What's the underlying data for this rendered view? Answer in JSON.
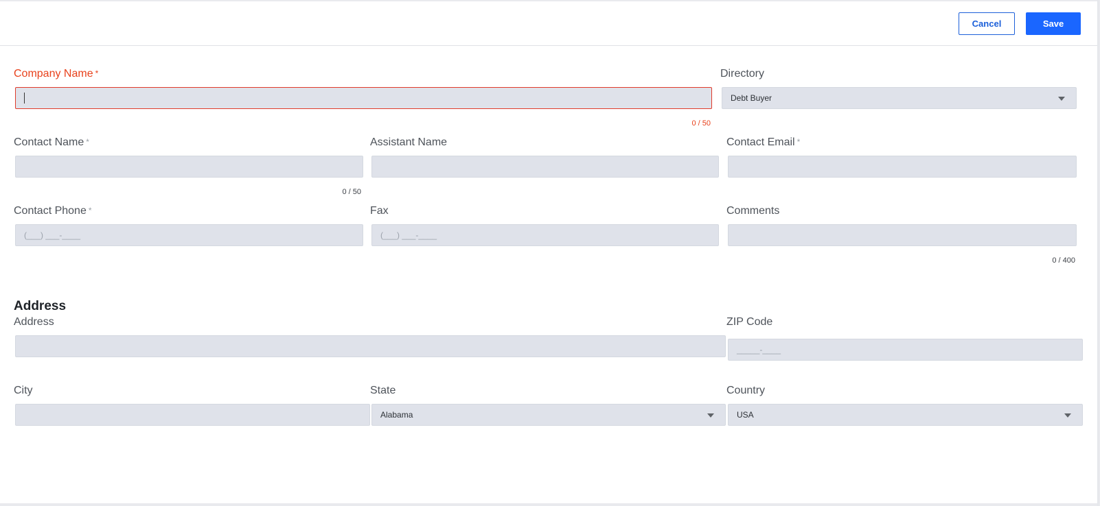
{
  "toolbar": {
    "cancel_label": "Cancel",
    "save_label": "Save"
  },
  "fields": {
    "company_name": {
      "label": "Company Name",
      "required": "*",
      "value": "",
      "counter": "0 / 50"
    },
    "directory": {
      "label": "Directory",
      "selected": "Debt Buyer"
    },
    "contact_name": {
      "label": "Contact Name",
      "required": "*",
      "value": "",
      "counter": "0 / 50"
    },
    "assistant_name": {
      "label": "Assistant Name",
      "value": ""
    },
    "contact_email": {
      "label": "Contact Email",
      "required": "*",
      "value": ""
    },
    "contact_phone": {
      "label": "Contact Phone",
      "required": "*",
      "placeholder": "(___) ___-____"
    },
    "fax": {
      "label": "Fax",
      "placeholder": "(___) ___-____"
    },
    "comments": {
      "label": "Comments",
      "value": "",
      "counter": "0 / 400"
    }
  },
  "address_section": {
    "title": "Address",
    "address": {
      "label": "Address",
      "value": ""
    },
    "zip": {
      "label": "ZIP Code",
      "placeholder": "_____-____"
    },
    "city": {
      "label": "City",
      "value": ""
    },
    "state": {
      "label": "State",
      "selected": "Alabama"
    },
    "country": {
      "label": "Country",
      "selected": "USA"
    }
  },
  "colors": {
    "primary": "#1a66ff",
    "error": "#e8411b",
    "field_bg": "#dfe2ea"
  }
}
